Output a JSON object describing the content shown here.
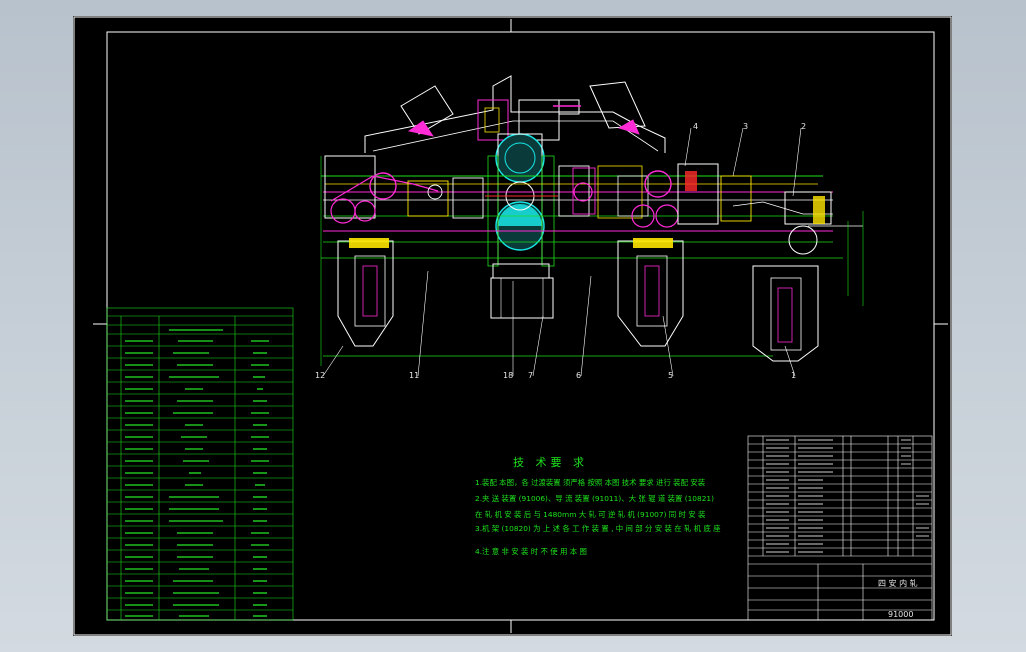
{
  "drawing": {
    "callouts": [
      "12",
      "11",
      "18",
      "7",
      "6",
      "5",
      "1",
      "4",
      "3",
      "2"
    ],
    "tech_requirements": {
      "title": "技 术要 求",
      "lines": [
        "1.装配 本图，各 过渡装置 须严格 按照 本图 技术 要求 进行 装配 安装",
        "2.夹 送 装置 (91006)、导 流 装置 (91011)、大 张 辊 道 装置 (10821)",
        "在 轧 机 安 装 后 与 1480mm 大 轧 可 逆 轧 机 (91007) 同 时 安 装",
        "3.机 架 (10820) 为 上 述 各 工 作 装 置 , 中 间 部 分 安 装 在 轧 机 底 座",
        "4.注 意 非 安 装 时 不 使 用 本 图"
      ]
    },
    "title_block": {
      "name": "四 安 内 轧",
      "drawing_number": "91000"
    },
    "colors": {
      "background": "#000000",
      "frame": "#ffffff",
      "green": "#1de21d",
      "magenta": "#ff2bd6",
      "cyan": "#19e6e6",
      "yellow": "#ffe600",
      "red": "#ff2a2a"
    }
  }
}
